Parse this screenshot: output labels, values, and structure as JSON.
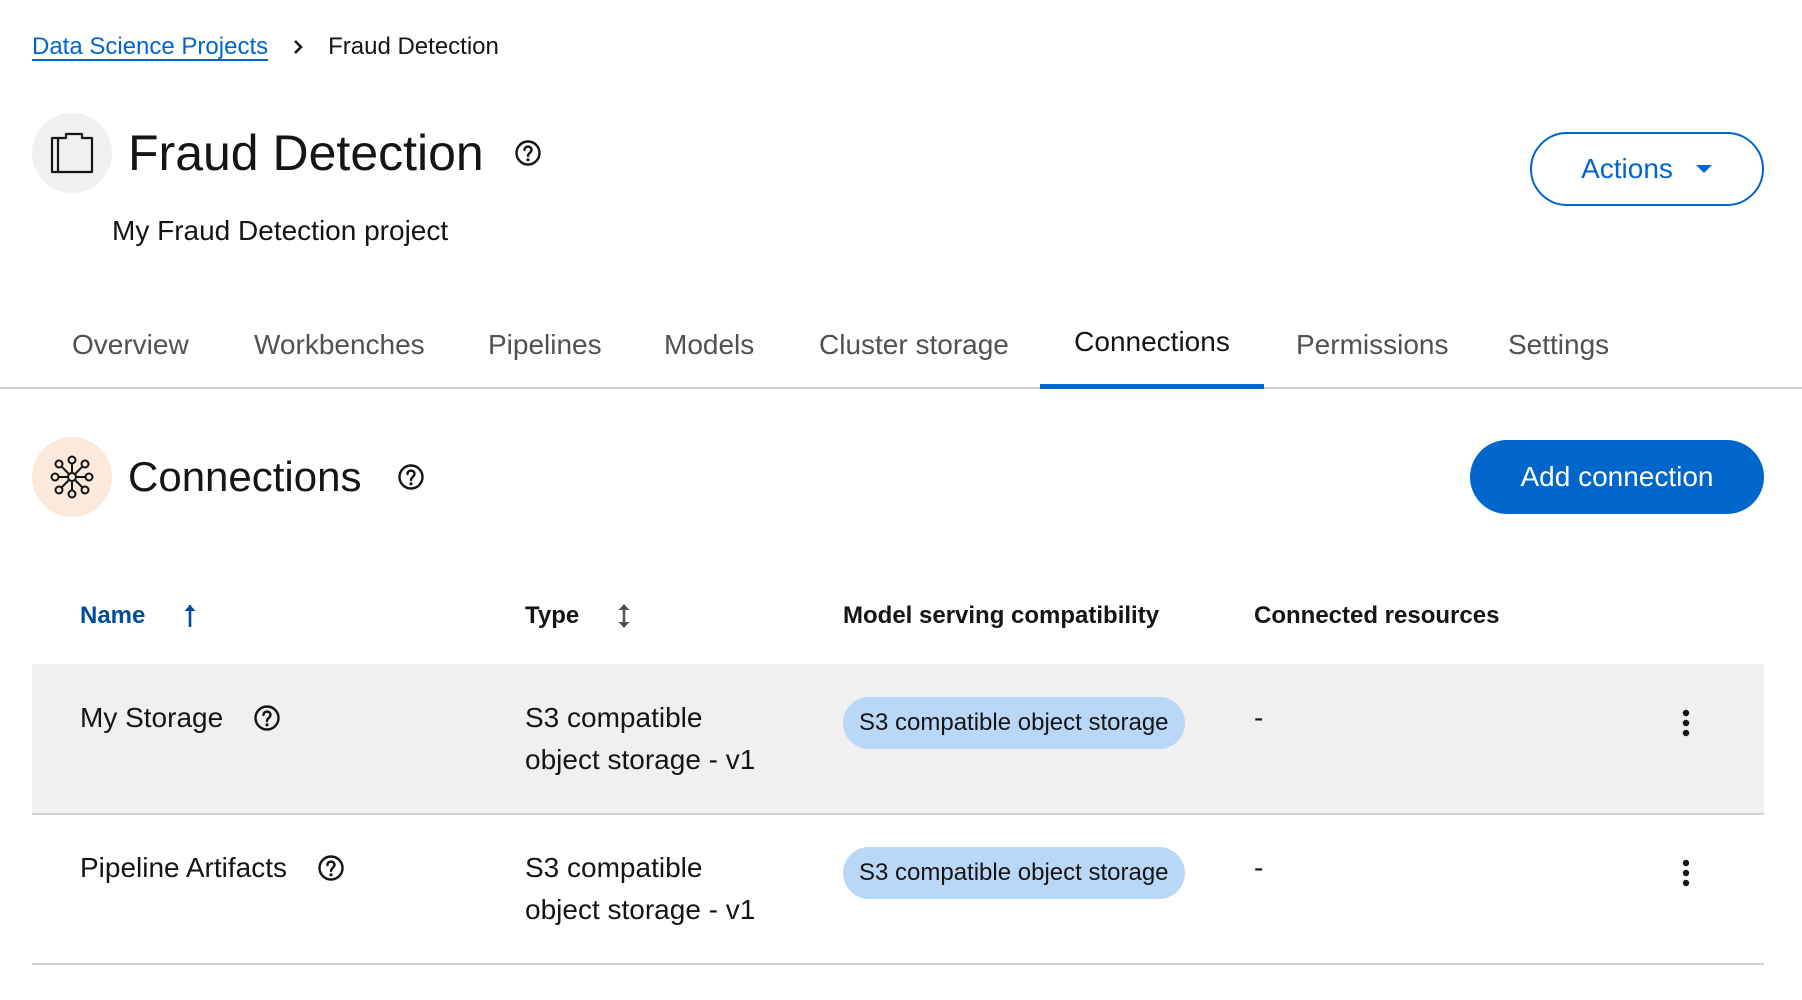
{
  "breadcrumb": {
    "parent": "Data Science Projects",
    "current": "Fraud Detection"
  },
  "project": {
    "title": "Fraud Detection",
    "description": "My Fraud Detection project",
    "actions_label": "Actions"
  },
  "tabs": [
    {
      "label": "Overview"
    },
    {
      "label": "Workbenches"
    },
    {
      "label": "Pipelines"
    },
    {
      "label": "Models"
    },
    {
      "label": "Cluster storage"
    },
    {
      "label": "Connections",
      "active": true
    },
    {
      "label": "Permissions"
    },
    {
      "label": "Settings"
    }
  ],
  "section": {
    "title": "Connections",
    "add_button_label": "Add connection"
  },
  "table": {
    "columns": {
      "name": "Name",
      "type": "Type",
      "compat": "Model serving compatibility",
      "resources": "Connected resources"
    },
    "rows": [
      {
        "name": "My Storage",
        "type_line1": "S3 compatible",
        "type_line2": "object storage - v1",
        "compat": "S3 compatible object storage",
        "resources": "-"
      },
      {
        "name": "Pipeline Artifacts",
        "type_line1": "S3 compatible",
        "type_line2": "object storage - v1",
        "compat": "S3 compatible object storage",
        "resources": "-"
      }
    ]
  },
  "colors": {
    "primary": "#0066cc",
    "sorted_header": "#004d99",
    "label_bg": "#b9d7f6",
    "section_icon_bg": "#fbeadb",
    "row_highlight": "#f0f0f0"
  }
}
